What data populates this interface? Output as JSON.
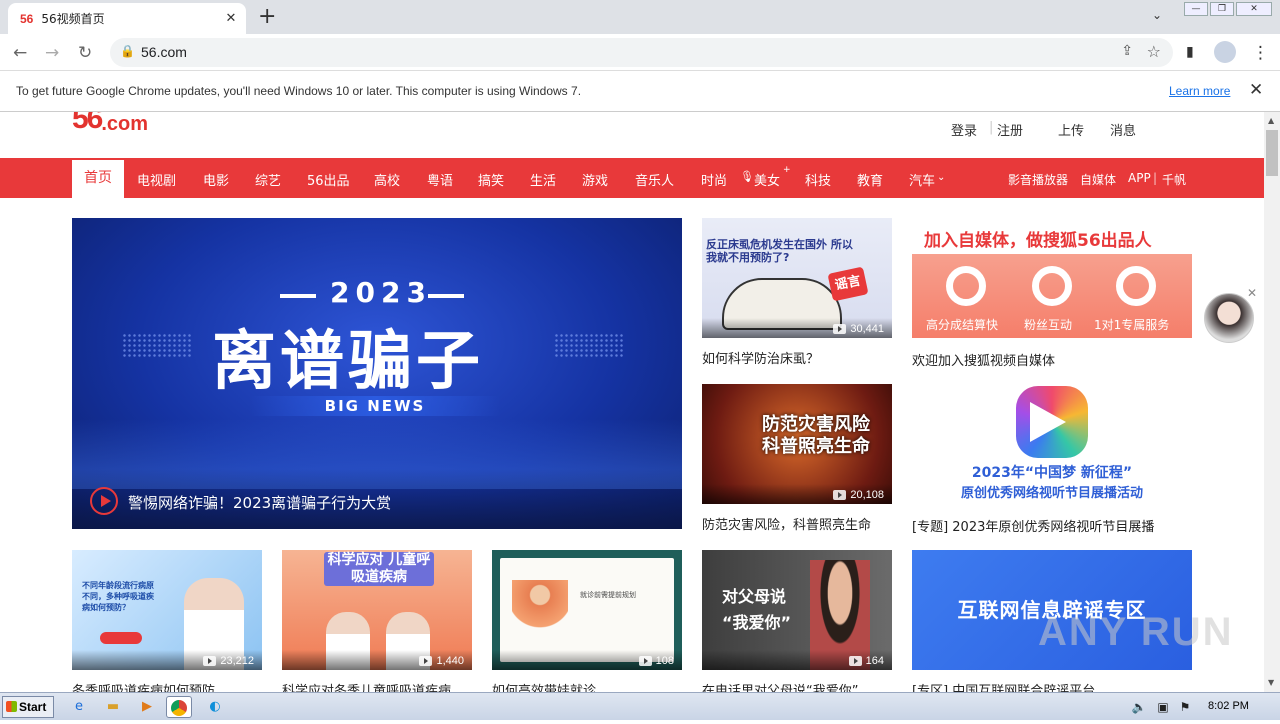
{
  "browser": {
    "tab_title": "56视频首页",
    "tab_favicon": "56",
    "url": "56.com",
    "infobar_message": "To get future Google Chrome updates, you'll need Windows 10 or later. This computer is using Windows 7.",
    "infobar_link": "Learn more"
  },
  "site": {
    "logo_num": "56",
    "logo_tld": ".com",
    "user_links": [
      "登录",
      "注册",
      "上传",
      "消息"
    ],
    "nav": [
      "首页",
      "电视剧",
      "电影",
      "综艺",
      "56出品",
      "高校",
      "粤语",
      "搞笑",
      "生活",
      "游戏",
      "音乐人",
      "时尚",
      "美女",
      "科技",
      "教育",
      "汽车"
    ],
    "nav_right": [
      "影音播放器",
      "自媒体",
      "APP",
      "千帆"
    ]
  },
  "hero": {
    "year": "2023",
    "big": "离谱骗子",
    "news": "BIG NEWS",
    "title": "警惕网络诈骗！2023离谱骗子行为大赏"
  },
  "videos": [
    {
      "caption": "如何科学防治床虱？",
      "count": "30,441",
      "thumb_text": "反正床虱危机发生在国外 所以我就不用预防了?",
      "stamp": "谣言"
    },
    {
      "caption": "防范灾害风险，科普照亮生命",
      "count": "20,108",
      "thumb_text": "防范灾害风险 科普照亮生命"
    },
    {
      "caption": "冬季呼吸道疾病如何预防",
      "count": "23,212",
      "thumb_text": "不同年龄段流行病原不同，多种呼吸道疾病如何预防？"
    },
    {
      "caption": "科学应对冬季儿童呼吸道疾病",
      "count": "1,440",
      "thumb_text": "科学应对 儿童呼吸道疾病"
    },
    {
      "caption": "如何高效带娃就诊",
      "count": "108",
      "thumb_text": "就诊前需提前规划"
    },
    {
      "caption": "在电话里对父母说“我爱你”",
      "count": "164",
      "thumb_text": "对父母说 “我爱你”"
    }
  ],
  "side": [
    {
      "caption": "欢迎加入搜狐视频自媒体",
      "banner": "加入自媒体，做搜狐56出品人",
      "items": [
        "高分成结算快",
        "粉丝互动",
        "1对1专属服务"
      ]
    },
    {
      "caption": "[专题] 2023年原创优秀网络视听节目展播",
      "banner": "2023年“中国梦 新征程”",
      "sub": "原创优秀网络视听节目展播活动"
    },
    {
      "caption": "[专区] 中国互联网联合辟谣平台",
      "banner": "互联网信息辟谣专区"
    }
  ],
  "watermark": "ANY RUN",
  "taskbar": {
    "start": "Start",
    "time": "8:02 PM"
  }
}
